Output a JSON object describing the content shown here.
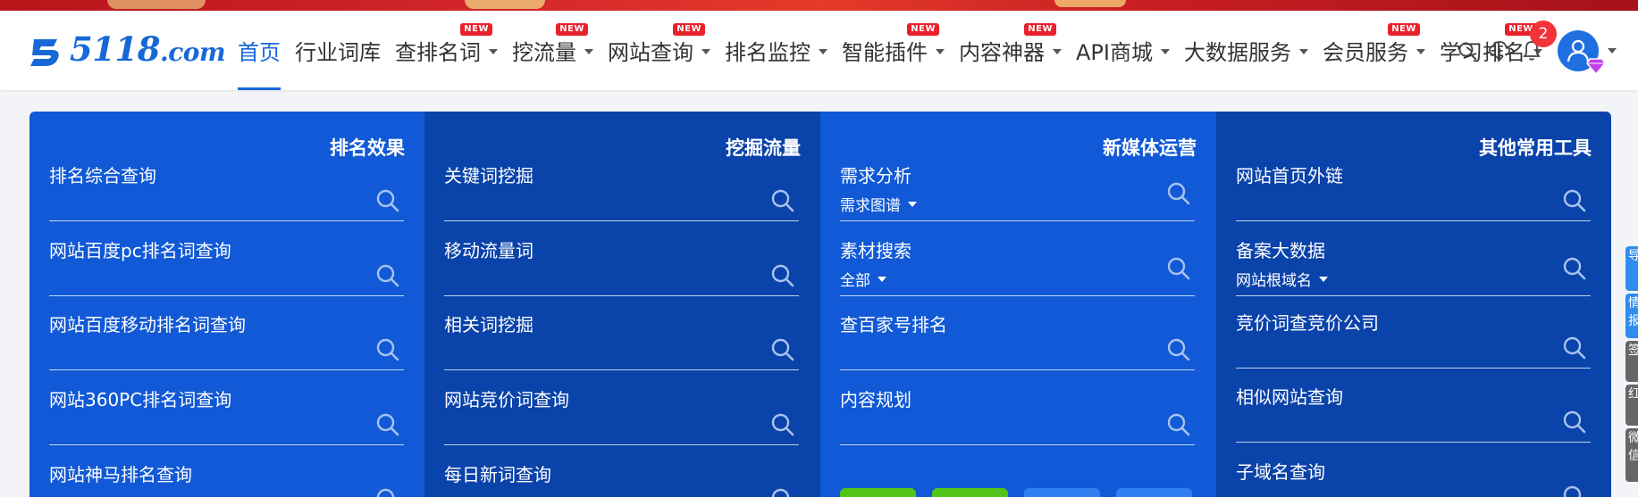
{
  "nav": {
    "logo_text": "5118",
    "logo_suffix": ".com",
    "items": [
      {
        "label": "首页",
        "active": true,
        "caret": false,
        "new": false
      },
      {
        "label": "行业词库",
        "active": false,
        "caret": false,
        "new": false
      },
      {
        "label": "查排名词",
        "active": false,
        "caret": true,
        "new": true
      },
      {
        "label": "挖流量",
        "active": false,
        "caret": true,
        "new": true
      },
      {
        "label": "网站查询",
        "active": false,
        "caret": true,
        "new": true
      },
      {
        "label": "排名监控",
        "active": false,
        "caret": true,
        "new": false
      },
      {
        "label": "智能插件",
        "active": false,
        "caret": true,
        "new": true
      },
      {
        "label": "内容神器",
        "active": false,
        "caret": true,
        "new": true
      },
      {
        "label": "API商城",
        "active": false,
        "caret": true,
        "new": false
      },
      {
        "label": "大数据服务",
        "active": false,
        "caret": true,
        "new": false
      },
      {
        "label": "会员服务",
        "active": false,
        "caret": true,
        "new": true
      },
      {
        "label": "学习排名",
        "active": false,
        "caret": true,
        "new": true
      }
    ],
    "new_badge": "NEW",
    "notification_count": "2",
    "icons": [
      "search-icon",
      "cloud-download-icon",
      "bell-icon",
      "user-avatar-icon"
    ]
  },
  "panel": {
    "columns": [
      {
        "title": "排名效果",
        "tools": [
          {
            "name": "排名综合查询",
            "sub": ""
          },
          {
            "name": "网站百度pc排名词查询",
            "sub": ""
          },
          {
            "name": "网站百度移动排名词查询",
            "sub": ""
          },
          {
            "name": "网站360PC排名词查询",
            "sub": ""
          },
          {
            "name": "网站神马排名查询",
            "sub": ""
          }
        ]
      },
      {
        "title": "挖掘流量",
        "tools": [
          {
            "name": "关键词挖掘",
            "sub": ""
          },
          {
            "name": "移动流量词",
            "sub": ""
          },
          {
            "name": "相关词挖掘",
            "sub": ""
          },
          {
            "name": "网站竞价词查询",
            "sub": ""
          },
          {
            "name": "每日新词查询",
            "sub": ""
          }
        ]
      },
      {
        "title": "新媒体运营",
        "tools": [
          {
            "name": "需求分析",
            "sub": "需求图谱"
          },
          {
            "name": "素材搜索",
            "sub": "全部"
          },
          {
            "name": "查百家号排名",
            "sub": ""
          },
          {
            "name": "内容规划",
            "sub": ""
          }
        ]
      },
      {
        "title": "其他常用工具",
        "tools": [
          {
            "name": "网站首页外链",
            "sub": ""
          },
          {
            "name": "备案大数据",
            "sub": "网站根域名"
          },
          {
            "name": "竞价词查竞价公司",
            "sub": ""
          },
          {
            "name": "相似网站查询",
            "sub": ""
          },
          {
            "name": "子域名查询",
            "sub": ""
          }
        ]
      }
    ]
  },
  "side_tabs": [
    {
      "label": "导",
      "color": "#2f8cf0"
    },
    {
      "label": "情报",
      "color": "#2f8cf0"
    },
    {
      "label": "签",
      "color": "#666666"
    },
    {
      "label": "红",
      "color": "#666666"
    },
    {
      "label": "微信",
      "color": "#666666"
    }
  ],
  "colors": {
    "brand": "#1769d8",
    "panel_light": "#1159d6",
    "panel_dark": "#0a43aa",
    "new_badge": "#e8212b",
    "green_button": "#52c41a"
  }
}
